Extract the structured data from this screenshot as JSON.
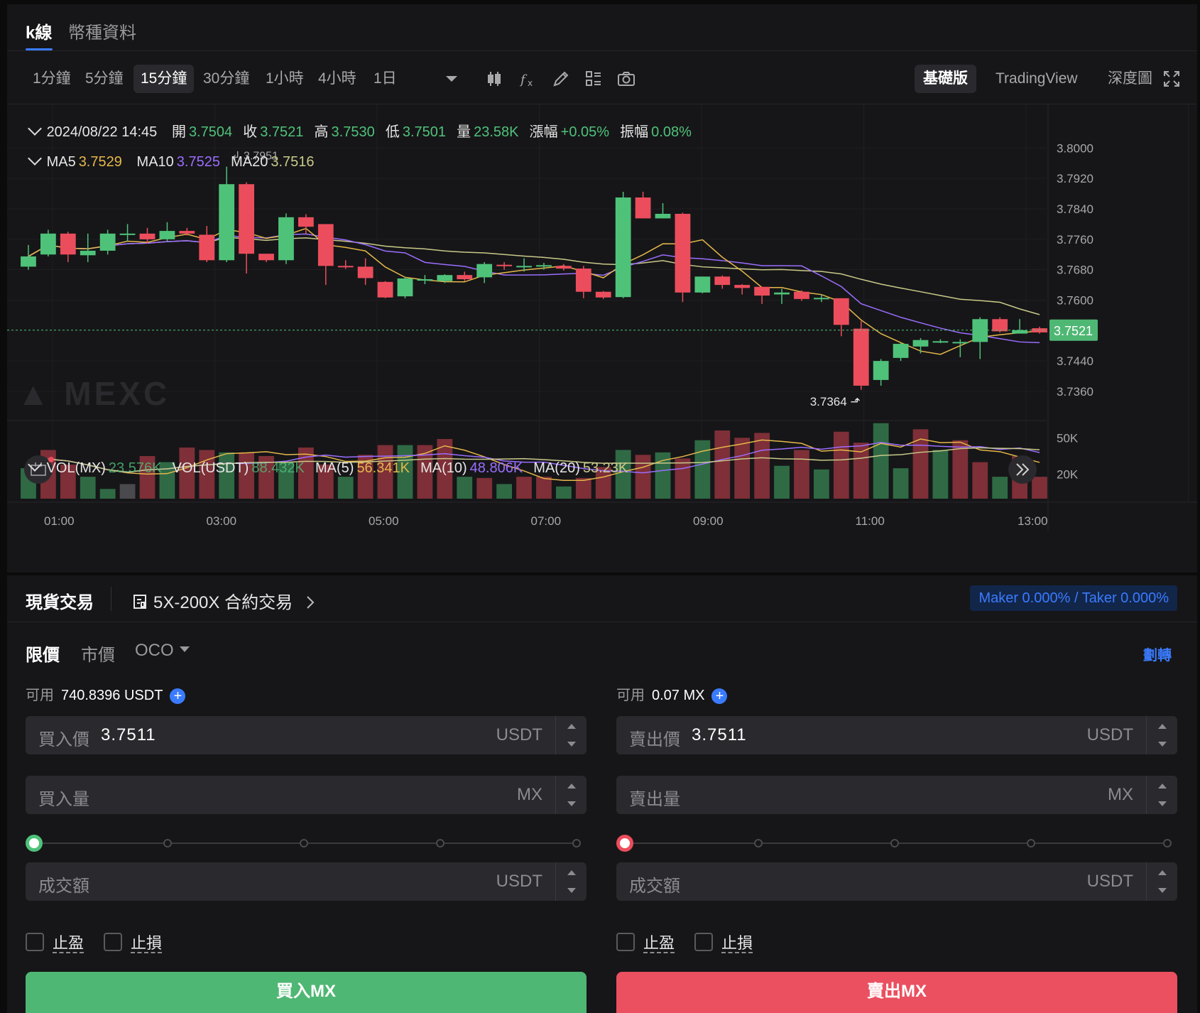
{
  "tabs": {
    "kline": "k線",
    "coin_info": "幣種資料"
  },
  "timeframes": [
    "1分鐘",
    "5分鐘",
    "15分鐘",
    "30分鐘",
    "1小時",
    "4小時",
    "1日"
  ],
  "active_timeframe": "15分鐘",
  "views": {
    "basic": "基礎版",
    "tradingview": "TradingView",
    "depth": "深度圖"
  },
  "ohlc": {
    "date": "2024/08/22 14:45",
    "open_label": "開",
    "open": "3.7504",
    "close_label": "收",
    "close": "3.7521",
    "high_label": "高",
    "high": "3.7530",
    "low_label": "低",
    "low": "3.7501",
    "vol_label": "量",
    "vol": "23.58K",
    "chg_label": "漲幅",
    "chg": "+0.05%",
    "amp_label": "振幅",
    "amp": "0.08%"
  },
  "ma": {
    "ma5_label": "MA5",
    "ma5": "3.7529",
    "ma10_label": "MA10",
    "ma10": "3.7525",
    "ma20_label": "MA20",
    "ma20": "3.7516"
  },
  "volume_info": {
    "vol_mx_label": "VOL(MX)",
    "vol_mx": "23.576K",
    "vol_usdt_label": "VOL(USDT)",
    "vol_usdt": "88.432K",
    "ma5_label": "MA(5)",
    "ma5": "56.341K",
    "ma10_label": "MA(10)",
    "ma10": "48.806K",
    "ma20_label": "MA(20)",
    "ma20": "53.23K"
  },
  "watermark": "MEXC",
  "colors": {
    "up": "#4fc27a",
    "down": "#ec4d5c",
    "ma5": "#e5b74a",
    "ma10": "#9b6dff",
    "ma20": "#c9c98a",
    "accent": "#3a7bff"
  },
  "chart_data": {
    "type": "candlestick",
    "price_axis_ticks": [
      "3.8000",
      "3.7920",
      "3.7840",
      "3.7760",
      "3.7680",
      "3.7600",
      "3.7440",
      "3.7360"
    ],
    "ylim": [
      3.733,
      3.804
    ],
    "current_price": "3.7521",
    "max_label": "3.7951",
    "min_label": "3.7364",
    "time_ticks": [
      "01:00",
      "03:00",
      "05:00",
      "07:00",
      "09:00",
      "11:00",
      "13:00"
    ],
    "volume_ticks": [
      "50K",
      "20K"
    ],
    "candles": [
      {
        "o": 3.7688,
        "c": 3.7715,
        "h": 3.7745,
        "l": 3.768
      },
      {
        "o": 3.772,
        "c": 3.7775,
        "h": 3.7785,
        "l": 3.7715
      },
      {
        "o": 3.7775,
        "c": 3.772,
        "h": 3.778,
        "l": 3.77
      },
      {
        "o": 3.7718,
        "c": 3.773,
        "h": 3.7775,
        "l": 3.77
      },
      {
        "o": 3.773,
        "c": 3.7775,
        "h": 3.7785,
        "l": 3.772
      },
      {
        "o": 3.7775,
        "c": 3.7775,
        "h": 3.78,
        "l": 3.7755
      },
      {
        "o": 3.7775,
        "c": 3.776,
        "h": 3.779,
        "l": 3.775
      },
      {
        "o": 3.776,
        "c": 3.7782,
        "h": 3.7805,
        "l": 3.7755
      },
      {
        "o": 3.7782,
        "c": 3.7775,
        "h": 3.779,
        "l": 3.777
      },
      {
        "o": 3.7772,
        "c": 3.7705,
        "h": 3.7795,
        "l": 3.77
      },
      {
        "o": 3.7705,
        "c": 3.7905,
        "h": 3.7951,
        "l": 3.77
      },
      {
        "o": 3.7905,
        "c": 3.7722,
        "h": 3.791,
        "l": 3.767
      },
      {
        "o": 3.7722,
        "c": 3.7705,
        "h": 3.7722,
        "l": 3.77
      },
      {
        "o": 3.7705,
        "c": 3.7818,
        "h": 3.7828,
        "l": 3.7695
      },
      {
        "o": 3.7818,
        "c": 3.7793,
        "h": 3.7826,
        "l": 3.7775
      },
      {
        "o": 3.78,
        "c": 3.769,
        "h": 3.78,
        "l": 3.764
      },
      {
        "o": 3.769,
        "c": 3.7688,
        "h": 3.7705,
        "l": 3.7682
      },
      {
        "o": 3.7688,
        "c": 3.7658,
        "h": 3.771,
        "l": 3.764
      },
      {
        "o": 3.7648,
        "c": 3.7607,
        "h": 3.765,
        "l": 3.7605
      },
      {
        "o": 3.761,
        "c": 3.7657,
        "h": 3.766,
        "l": 3.7605
      },
      {
        "o": 3.7652,
        "c": 3.7655,
        "h": 3.7666,
        "l": 3.7642
      },
      {
        "o": 3.765,
        "c": 3.7666,
        "h": 3.7668,
        "l": 3.7645
      },
      {
        "o": 3.7666,
        "c": 3.7655,
        "h": 3.7675,
        "l": 3.765
      },
      {
        "o": 3.766,
        "c": 3.7695,
        "h": 3.77,
        "l": 3.7645
      },
      {
        "o": 3.7693,
        "c": 3.769,
        "h": 3.77,
        "l": 3.768
      },
      {
        "o": 3.769,
        "c": 3.769,
        "h": 3.771,
        "l": 3.7675
      },
      {
        "o": 3.7692,
        "c": 3.7692,
        "h": 3.7698,
        "l": 3.768
      },
      {
        "o": 3.769,
        "c": 3.7683,
        "h": 3.7695,
        "l": 3.7678
      },
      {
        "o": 3.7683,
        "c": 3.7622,
        "h": 3.769,
        "l": 3.7605
      },
      {
        "o": 3.7622,
        "c": 3.7607,
        "h": 3.7624,
        "l": 3.7603
      },
      {
        "o": 3.7608,
        "c": 3.787,
        "h": 3.7885,
        "l": 3.7605
      },
      {
        "o": 3.787,
        "c": 3.7815,
        "h": 3.7885,
        "l": 3.7815
      },
      {
        "o": 3.7815,
        "c": 3.7827,
        "h": 3.7855,
        "l": 3.7815
      },
      {
        "o": 3.7827,
        "c": 3.762,
        "h": 3.783,
        "l": 3.7595
      },
      {
        "o": 3.762,
        "c": 3.7662,
        "h": 3.7662,
        "l": 3.7618
      },
      {
        "o": 3.7662,
        "c": 3.764,
        "h": 3.7665,
        "l": 3.763
      },
      {
        "o": 3.764,
        "c": 3.7632,
        "h": 3.7642,
        "l": 3.7615
      },
      {
        "o": 3.7635,
        "c": 3.7612,
        "h": 3.7636,
        "l": 3.759
      },
      {
        "o": 3.7615,
        "c": 3.762,
        "h": 3.763,
        "l": 3.759
      },
      {
        "o": 3.7622,
        "c": 3.7603,
        "h": 3.7626,
        "l": 3.7598
      },
      {
        "o": 3.7606,
        "c": 3.7606,
        "h": 3.7615,
        "l": 3.7595
      },
      {
        "o": 3.7605,
        "c": 3.7535,
        "h": 3.7605,
        "l": 3.7505
      },
      {
        "o": 3.7525,
        "c": 3.7375,
        "h": 3.7545,
        "l": 3.7364
      },
      {
        "o": 3.739,
        "c": 3.744,
        "h": 3.7445,
        "l": 3.7375
      },
      {
        "o": 3.7448,
        "c": 3.7485,
        "h": 3.7488,
        "l": 3.744
      },
      {
        "o": 3.7478,
        "c": 3.7495,
        "h": 3.75,
        "l": 3.746
      },
      {
        "o": 3.7492,
        "c": 3.7492,
        "h": 3.7497,
        "l": 3.7487
      },
      {
        "o": 3.749,
        "c": 3.749,
        "h": 3.7497,
        "l": 3.745
      },
      {
        "o": 3.749,
        "c": 3.755,
        "h": 3.7555,
        "l": 3.7445
      },
      {
        "o": 3.755,
        "c": 3.7518,
        "h": 3.7555,
        "l": 3.7515
      },
      {
        "o": 3.7512,
        "c": 3.7521,
        "h": 3.755,
        "l": 3.7512
      },
      {
        "o": 3.7526,
        "c": 3.7515,
        "h": 3.753,
        "l": 3.7512
      }
    ],
    "volumes": [
      25,
      40,
      28,
      18,
      8,
      12,
      35,
      30,
      42,
      40,
      38,
      38,
      35,
      30,
      42,
      28,
      18,
      36,
      44,
      44,
      44,
      49,
      18,
      17,
      12,
      18,
      18,
      10,
      17,
      26,
      40,
      36,
      38,
      33,
      48,
      56,
      50,
      54,
      27,
      40,
      24,
      55,
      46,
      62,
      25,
      57,
      40,
      48,
      30,
      18,
      35,
      18
    ],
    "volume_colors": [
      "up",
      "down",
      "down",
      "up",
      "up",
      "gray",
      "down",
      "up",
      "down",
      "down",
      "up",
      "down",
      "down",
      "up",
      "down",
      "down",
      "up",
      "down",
      "down",
      "up",
      "down",
      "down",
      "up",
      "down",
      "up",
      "down",
      "down",
      "up",
      "down",
      "down",
      "up",
      "down",
      "up",
      "down",
      "up",
      "down",
      "down",
      "down",
      "up",
      "down",
      "up",
      "down",
      "down",
      "up",
      "up",
      "down",
      "up",
      "down",
      "down",
      "up",
      "down",
      "down"
    ],
    "ylim_volume": [
      0,
      70
    ]
  },
  "trade": {
    "spot": "現貨交易",
    "contract": "5X-200X 合約交易",
    "fee": "Maker 0.000% / Taker 0.000%",
    "order_types": {
      "limit": "限價",
      "market": "市價",
      "oco": "OCO"
    },
    "transfer": "劃轉",
    "buy": {
      "avail_label": "可用",
      "avail_value": "740.8396 USDT",
      "price_label": "買入價",
      "price_value": "3.7511",
      "price_unit": "USDT",
      "qty_label": "買入量",
      "qty_unit": "MX",
      "total_label": "成交額",
      "total_unit": "USDT",
      "tp": "止盈",
      "sl": "止損",
      "button": "買入MX"
    },
    "sell": {
      "avail_label": "可用",
      "avail_value": "0.07 MX",
      "price_label": "賣出價",
      "price_value": "3.7511",
      "price_unit": "USDT",
      "qty_label": "賣出量",
      "qty_unit": "MX",
      "total_label": "成交額",
      "total_unit": "USDT",
      "tp": "止盈",
      "sl": "止損",
      "button": "賣出MX"
    }
  }
}
